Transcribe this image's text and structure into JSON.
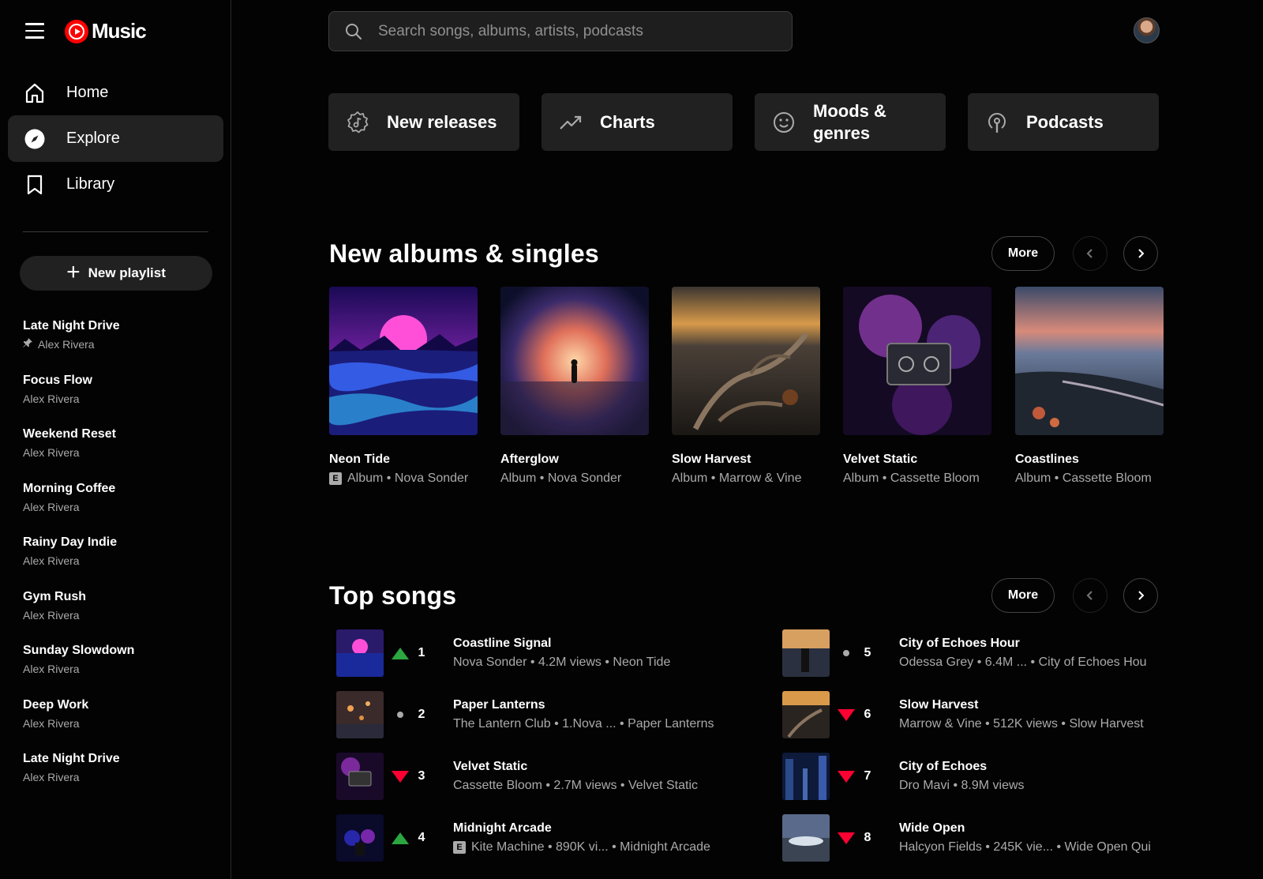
{
  "app": {
    "logo_text": "Music"
  },
  "nav": [
    {
      "label": "Home",
      "icon": "home-icon",
      "active": false
    },
    {
      "label": "Explore",
      "icon": "explore-icon",
      "active": true
    },
    {
      "label": "Library",
      "icon": "library-icon",
      "active": false
    }
  ],
  "new_playlist_label": "New playlist",
  "playlists": [
    {
      "title": "Late Night Drive",
      "owner": "Alex Rivera",
      "pinned": true
    },
    {
      "title": "Focus Flow",
      "owner": "Alex Rivera"
    },
    {
      "title": "Weekend Reset",
      "owner": "Alex Rivera"
    },
    {
      "title": "Morning Coffee",
      "owner": "Alex Rivera"
    },
    {
      "title": "Rainy Day Indie",
      "owner": "Alex Rivera"
    },
    {
      "title": "Gym Rush",
      "owner": "Alex Rivera"
    },
    {
      "title": "Sunday Slowdown",
      "owner": "Alex Rivera"
    },
    {
      "title": "Deep Work",
      "owner": "Alex Rivera"
    },
    {
      "title": "Late Night Drive",
      "owner": "Alex Rivera"
    }
  ],
  "search": {
    "placeholder": "Search songs, albums, artists, podcasts"
  },
  "categories": [
    {
      "label": "New releases",
      "icon": "new-releases-icon"
    },
    {
      "label": "Charts",
      "icon": "trending-icon"
    },
    {
      "label": "Moods & genres",
      "icon": "mood-icon"
    },
    {
      "label": "Podcasts",
      "icon": "podcast-icon"
    }
  ],
  "albums_section": {
    "title": "New albums & singles",
    "more_label": "More",
    "items": [
      {
        "title": "Neon Tide",
        "subtitle": "Album • Nova Sonder",
        "explicit": true
      },
      {
        "title": "Afterglow",
        "subtitle": "Album • Nova Sonder",
        "explicit": false
      },
      {
        "title": "Slow Harvest",
        "subtitle": "Album • Marrow & Vine",
        "explicit": false
      },
      {
        "title": "Velvet Static",
        "subtitle": "Album • Cassette Bloom",
        "explicit": false
      },
      {
        "title": "Coastlines",
        "subtitle": "Album • Cassette Bloom",
        "explicit": false
      }
    ]
  },
  "songs_section": {
    "title": "Top songs",
    "more_label": "More",
    "items": [
      {
        "rank": "1",
        "trend": "up",
        "title": "Coastline Signal",
        "subtitle": "Nova Sonder • 4.2M views • Neon Tide",
        "explicit": false
      },
      {
        "rank": "2",
        "trend": "same",
        "title": "Paper Lanterns",
        "subtitle": "The Lantern Club • 1.Nova ...  • Paper Lanterns",
        "explicit": false
      },
      {
        "rank": "3",
        "trend": "down",
        "title": "Velvet Static",
        "subtitle": "Cassette Bloom • 2.7M views • Velvet Static",
        "explicit": false
      },
      {
        "rank": "4",
        "trend": "up",
        "title": "Midnight Arcade",
        "subtitle": "Kite Machine • 890K vi...  • Midnight Arcade",
        "explicit": true
      },
      {
        "rank": "5",
        "trend": "same",
        "title": "City of Echoes Hour",
        "subtitle": "Odessa Grey • 6.4M ...   • City of Echoes Hou",
        "explicit": false
      },
      {
        "rank": "6",
        "trend": "down",
        "title": "Slow Harvest",
        "subtitle": "Marrow & Vine • 512K views • Slow Harvest",
        "explicit": false
      },
      {
        "rank": "7",
        "trend": "down",
        "title": "City of Echoes",
        "subtitle": "Dro Mavi • 8.9M views",
        "explicit": false
      },
      {
        "rank": "8",
        "trend": "down",
        "title": "Wide Open",
        "subtitle": "Halcyon Fields • 245K vie...  • Wide Open Qui",
        "explicit": false
      }
    ]
  },
  "colors": {
    "background": "#030303",
    "surface": "#212121",
    "trend_up": "#2ba640",
    "trend_down": "#ff0033",
    "brand": "#ff0000"
  }
}
